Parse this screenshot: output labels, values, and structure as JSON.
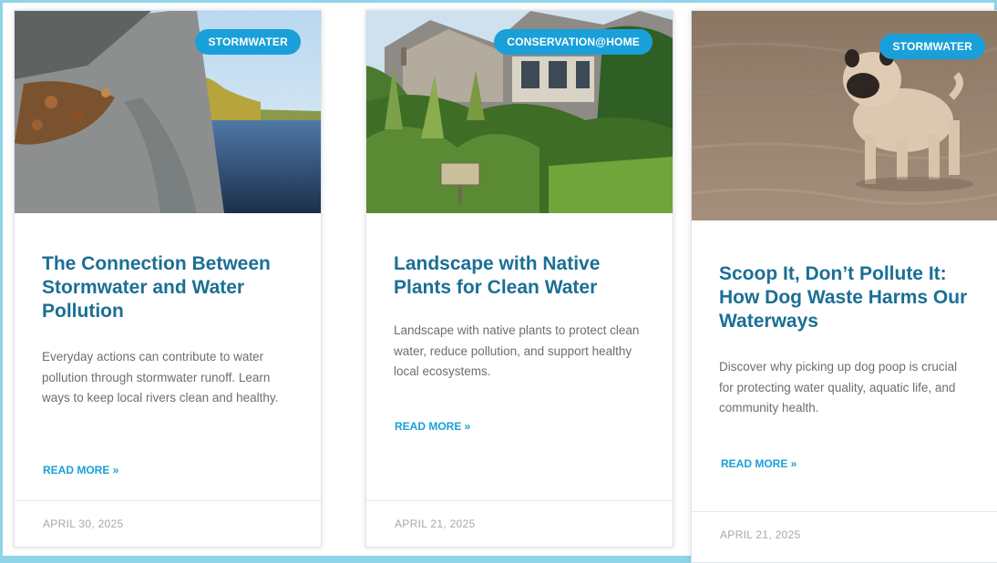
{
  "cards": [
    {
      "badge": "STORMWATER",
      "title": "The Connection Between Stormwater and Water Pollution",
      "excerpt": "Everyday actions can contribute to water pollution through stormwater runoff. Learn ways to keep local rivers clean and healthy.",
      "read_more": "READ MORE »",
      "date": "APRIL 30, 2025"
    },
    {
      "badge": "CONSERVATION@HOME",
      "title": "Landscape with Native Plants for Clean Water",
      "excerpt": "Landscape with native plants to protect clean water, reduce pollution, and support healthy local ecosystems.",
      "read_more": "READ MORE »",
      "date": "APRIL 21, 2025"
    },
    {
      "badge": "STORMWATER",
      "title": "Scoop It, Don’t Pollute It: How Dog Waste Harms Our Waterways",
      "excerpt": "Discover why picking up dog poop is crucial for protecting water quality, aquatic life, and community health.",
      "read_more": "READ MORE »",
      "date": "APRIL 21, 2025"
    }
  ],
  "colors": {
    "accent": "#1aa0d8",
    "title": "#1b6f94",
    "body_text": "#6a6f73",
    "meta_text": "#a4a9ad",
    "frame": "#8fd3e9"
  }
}
